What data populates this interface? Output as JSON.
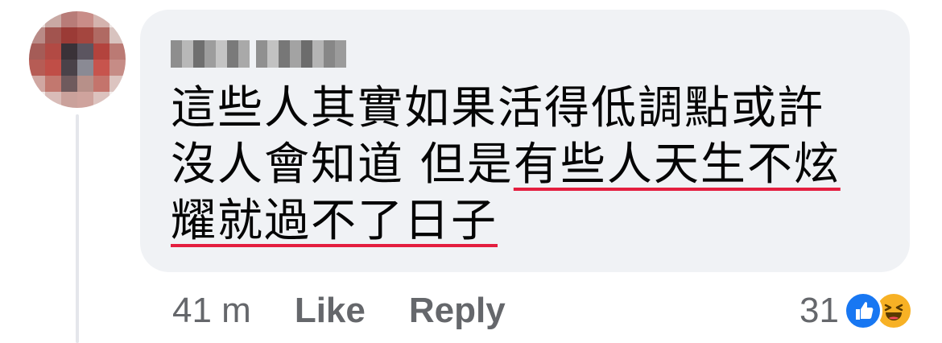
{
  "avatar": {
    "pixels": [
      [
        "#e6d9d6",
        "#c9a9a4",
        "#b87c78",
        "#c98d88",
        "#d4b3ae",
        "#efe6e4"
      ],
      [
        "#b98a86",
        "#a2544f",
        "#9b3b36",
        "#a4463f",
        "#b06a63",
        "#d8c3bf"
      ],
      [
        "#a55c57",
        "#b24a44",
        "#3a3238",
        "#5b5560",
        "#b3433d",
        "#bb7a74"
      ],
      [
        "#b65c55",
        "#c04e47",
        "#4a4249",
        "#8a8a94",
        "#c7544d",
        "#c68c86"
      ],
      [
        "#d0a7a2",
        "#c2786f",
        "#6f5a5d",
        "#b79089",
        "#c4746c",
        "#dcc4c0"
      ],
      [
        "#f1e9e8",
        "#d9bcb8",
        "#caa19b",
        "#cfa39d",
        "#dcc2be",
        "#f4eeed"
      ]
    ]
  },
  "comment": {
    "author_blur": {
      "words": [
        [
          "#8e8e8e",
          "#b8b8b8",
          "#6f6f6f",
          "#9d9d9d",
          "#c4c4c4",
          "#7a7a7a",
          "#a9a9a9"
        ],
        [
          "#909090",
          "#c2c2c2",
          "#777777",
          "#a3a3a3",
          "#6c6c6c",
          "#b4b4b4",
          "#878787",
          "#9b9b9b"
        ]
      ]
    },
    "lines": [
      {
        "plain": "這些人其實如果活得低調點或許",
        "underlined": ""
      },
      {
        "plain": "沒人會知道  但是",
        "underlined": "有些人天生不炫"
      },
      {
        "plain": "",
        "underlined": "耀就過不了日子"
      }
    ]
  },
  "actions": {
    "time": "41 m",
    "like_label": "Like",
    "reply_label": "Reply"
  },
  "reactions": {
    "count": "31",
    "icons": [
      "like-icon",
      "haha-icon"
    ],
    "like_color": "#1877f2",
    "haha_color": "#f7b125"
  }
}
